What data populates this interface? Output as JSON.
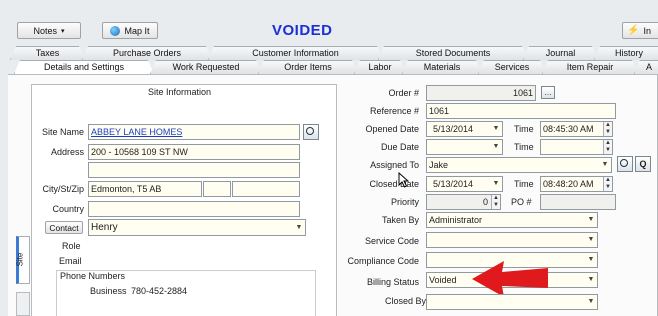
{
  "toolbar": {
    "notes_label": "Notes",
    "map_label": "Map It",
    "status_title": "VOIDED",
    "right_label": "In"
  },
  "tabs_back": [
    "Taxes",
    "Purchase Orders",
    "Customer Information",
    "Stored Documents",
    "Journal",
    "History"
  ],
  "tabs_front": [
    "Details and Settings",
    "Work Requested",
    "Order Items",
    "Labor",
    "Materials",
    "Services",
    "Item Repair",
    "A"
  ],
  "site_panel": {
    "title": "Site Information",
    "side_tab": "Site",
    "site_name_label": "Site Name",
    "site_name_value": "ABBEY LANE HOMES",
    "address_label": "Address",
    "address_value": "200 - 10568 109 ST NW",
    "city_label": "City/St/Zip",
    "city_value": "Edmonton, T5 AB",
    "country_label": "Country",
    "contact_label": "Contact",
    "contact_value": "Henry",
    "role_label": "Role",
    "email_label": "Email",
    "phone_label": "Phone Numbers",
    "business_label": "Business",
    "business_value": "780-452-2884"
  },
  "order": {
    "order_label": "Order #",
    "order_value": "1061",
    "reference_label": "Reference #",
    "reference_value": "1061",
    "opened_label": "Opened Date",
    "opened_date": "5/13/2014",
    "time_label": "Time",
    "opened_time": "08:45:30 AM",
    "due_label": "Due Date",
    "assigned_label": "Assigned To",
    "assigned_value": "Jake",
    "closed_label": "Closed Date",
    "closed_date": "5/13/2014",
    "closed_time": "08:48:20 AM",
    "priority_label": "Priority",
    "priority_value": "0",
    "po_label": "PO #",
    "taken_label": "Taken By",
    "taken_value": "Administrator",
    "service_label": "Service Code",
    "compliance_label": "Compliance Code",
    "billing_label": "Billing Status",
    "billing_value": "Voided",
    "last_label": "Closed By"
  },
  "colors": {
    "title_blue": "#1b2fd6",
    "arrow_red": "#e0191c",
    "field_yellow": "#fffef0"
  }
}
